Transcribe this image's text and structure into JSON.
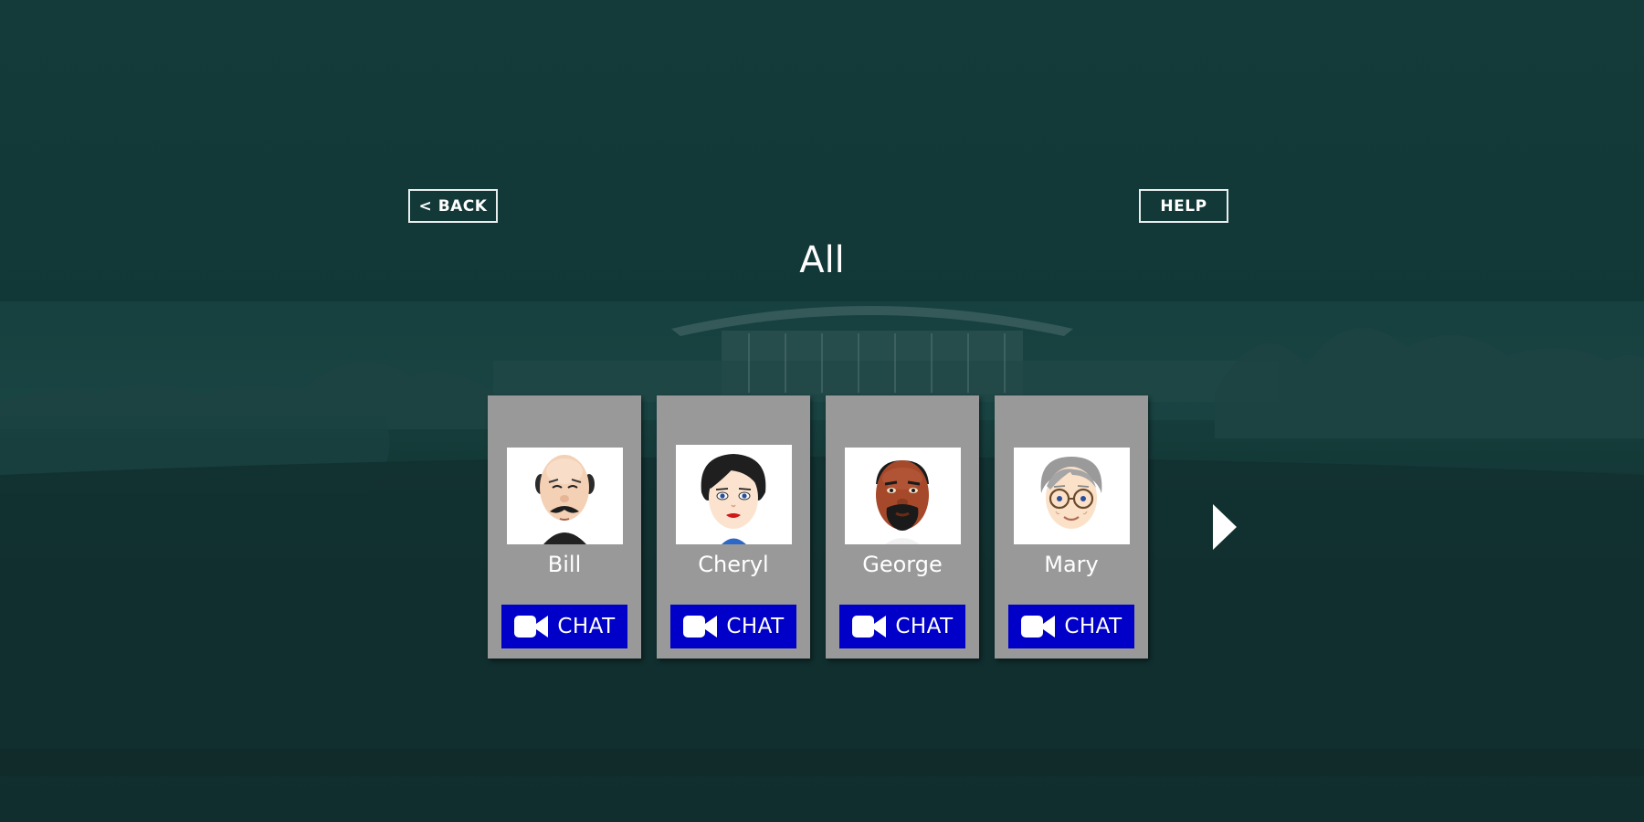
{
  "header": {
    "back_label": "< BACK",
    "help_label": "HELP",
    "title": "All"
  },
  "contacts": [
    {
      "name": "Bill",
      "chat_label": "CHAT",
      "avatar_icon": "bald-man-mustache-avatar"
    },
    {
      "name": "Cheryl",
      "chat_label": "CHAT",
      "avatar_icon": "woman-dark-hair-avatar"
    },
    {
      "name": "George",
      "chat_label": "CHAT",
      "avatar_icon": "man-beard-avatar"
    },
    {
      "name": "Mary",
      "chat_label": "CHAT",
      "avatar_icon": "elderly-woman-glasses-avatar"
    }
  ],
  "icons": {
    "chat": "video-camera-icon",
    "next": "next-arrow-icon"
  },
  "colors": {
    "background": "#143a3a",
    "card": "#999999",
    "chat_button": "#0000c8",
    "text": "#ffffff"
  }
}
